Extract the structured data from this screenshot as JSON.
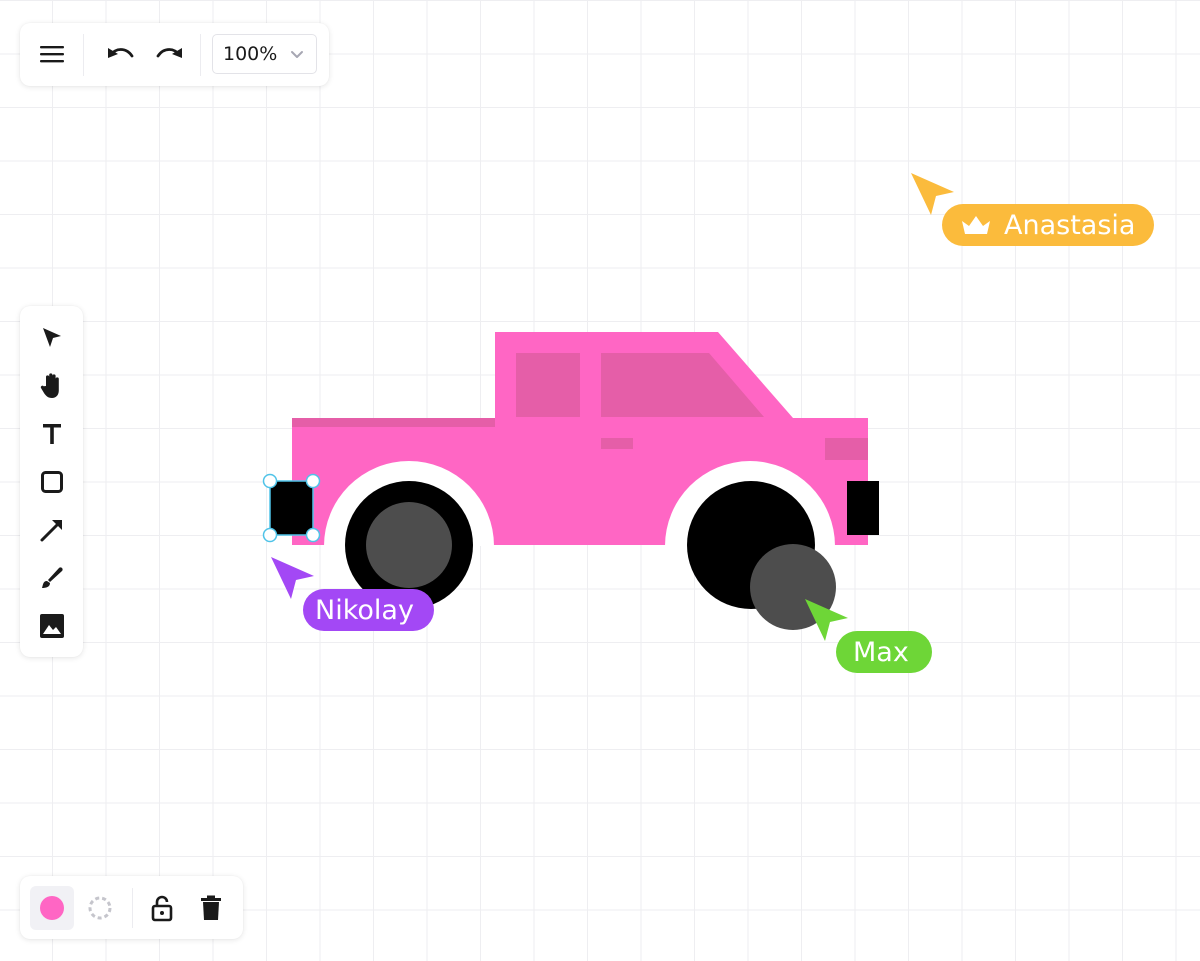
{
  "toolbar": {
    "menu_icon": "hamburger-menu-icon",
    "undo_icon": "undo-icon",
    "redo_icon": "redo-icon",
    "zoom_value": "100%",
    "zoom_chevron_icon": "chevron-down-icon"
  },
  "tools": [
    {
      "name": "select",
      "icon": "pointer-arrow-icon"
    },
    {
      "name": "hand",
      "icon": "hand-icon"
    },
    {
      "name": "text",
      "icon": "text-icon"
    },
    {
      "name": "rectangle",
      "icon": "square-icon"
    },
    {
      "name": "arrow",
      "icon": "arrow-icon"
    },
    {
      "name": "brush",
      "icon": "brush-icon"
    },
    {
      "name": "image",
      "icon": "image-icon"
    }
  ],
  "bottom_bar": {
    "fill_color": "#ff66c4",
    "stroke_icon": "dashed-circle-icon",
    "lock_icon": "unlock-icon",
    "delete_icon": "trash-icon"
  },
  "canvas": {
    "colors": {
      "body": "#ff66c4",
      "window": "#e55ea8",
      "wheel": "#000000",
      "hub": "#4d4d4d",
      "selection": "#4fc3e8"
    }
  },
  "collaborators": [
    {
      "name": "Anastasia",
      "color": "#fbbb3c",
      "crown_icon": "crown-icon"
    },
    {
      "name": "Nikolay",
      "color": "#a348f5"
    },
    {
      "name": "Max",
      "color": "#6ed637"
    }
  ]
}
